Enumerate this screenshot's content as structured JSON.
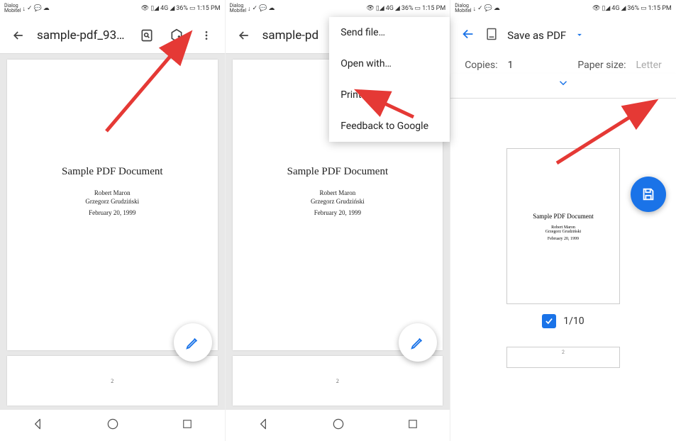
{
  "status": {
    "carrier_top": "Dialog",
    "carrier_bottom": "Mobitel",
    "battery": "36%",
    "time": "1:15 PM",
    "network_label": "4G"
  },
  "panel1": {
    "title": "sample-pdf_935…",
    "doc": {
      "title": "Sample PDF Document",
      "author1": "Robert Maron",
      "author2": "Grzegorz Grudziński",
      "date": "February 20, 1999"
    },
    "page2_num": "2"
  },
  "panel2": {
    "title": "sample-pd",
    "menu": {
      "send": "Send file…",
      "open": "Open with…",
      "print": "Print",
      "feedback": "Feedback to Google"
    },
    "doc": {
      "title": "Sample PDF Document",
      "author1": "Robert Maron",
      "author2": "Grzegorz Grudziński",
      "date": "February 20, 1999"
    },
    "page2_num": "2"
  },
  "panel3": {
    "save_as": "Save as PDF",
    "copies_label": "Copies:",
    "copies_value": "1",
    "paper_label": "Paper size:",
    "paper_value": "Letter",
    "doc": {
      "title": "Sample PDF Document",
      "author1": "Robert Maron",
      "author2": "Grzegorz Grudziński",
      "date": "February 20, 1999"
    },
    "page_counter": "1/10",
    "page2_num": "2"
  }
}
